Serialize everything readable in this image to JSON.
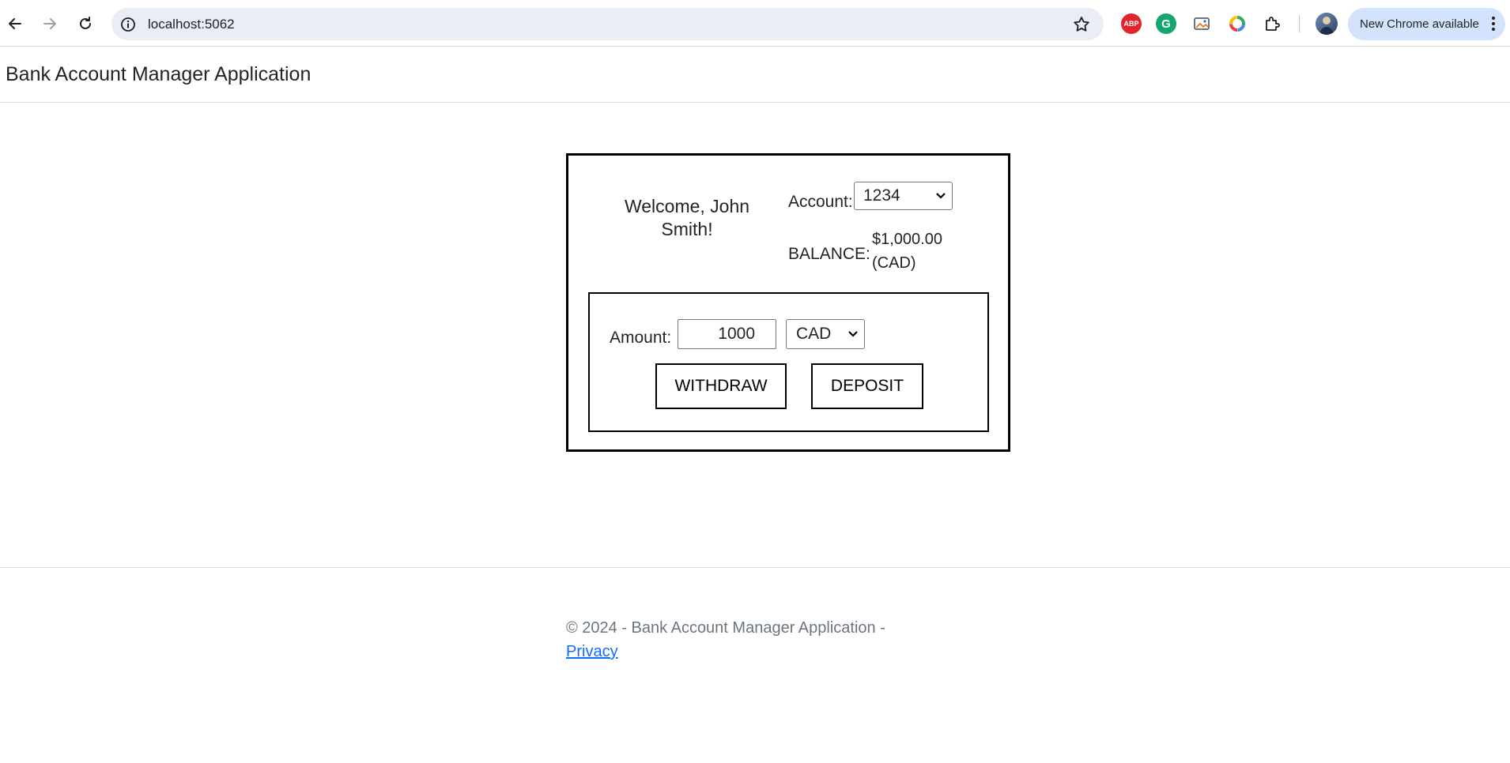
{
  "browser": {
    "url": "localhost:5062",
    "update_label": "New Chrome available",
    "extensions": [
      "adblock-plus-icon",
      "grammarly-icon",
      "image-extension-icon",
      "color-ring-extension-icon",
      "extensions-puzzle-icon"
    ],
    "abp_text": "ABP",
    "grammarly_text": "G"
  },
  "navbar": {
    "brand": "Bank Account Manager Application"
  },
  "account_panel": {
    "welcome": "Welcome, John Smith!",
    "account_label": "Account:",
    "account_selected": "1234",
    "balance_label": "BALANCE:",
    "balance_value": "$1,000.00 (CAD)"
  },
  "transaction": {
    "amount_label": "Amount:",
    "amount_value": "1000",
    "currency_selected": "CAD",
    "withdraw_label": "WITHDRAW",
    "deposit_label": "DEPOSIT"
  },
  "footer": {
    "copyright": "© 2024 - Bank Account Manager Application -",
    "privacy_link": "Privacy"
  },
  "colors": {
    "link": "#0d6efd",
    "footer_text": "#6c757d",
    "omnibox_bg": "#e9eef6",
    "update_pill_bg": "#d3e3fd"
  }
}
